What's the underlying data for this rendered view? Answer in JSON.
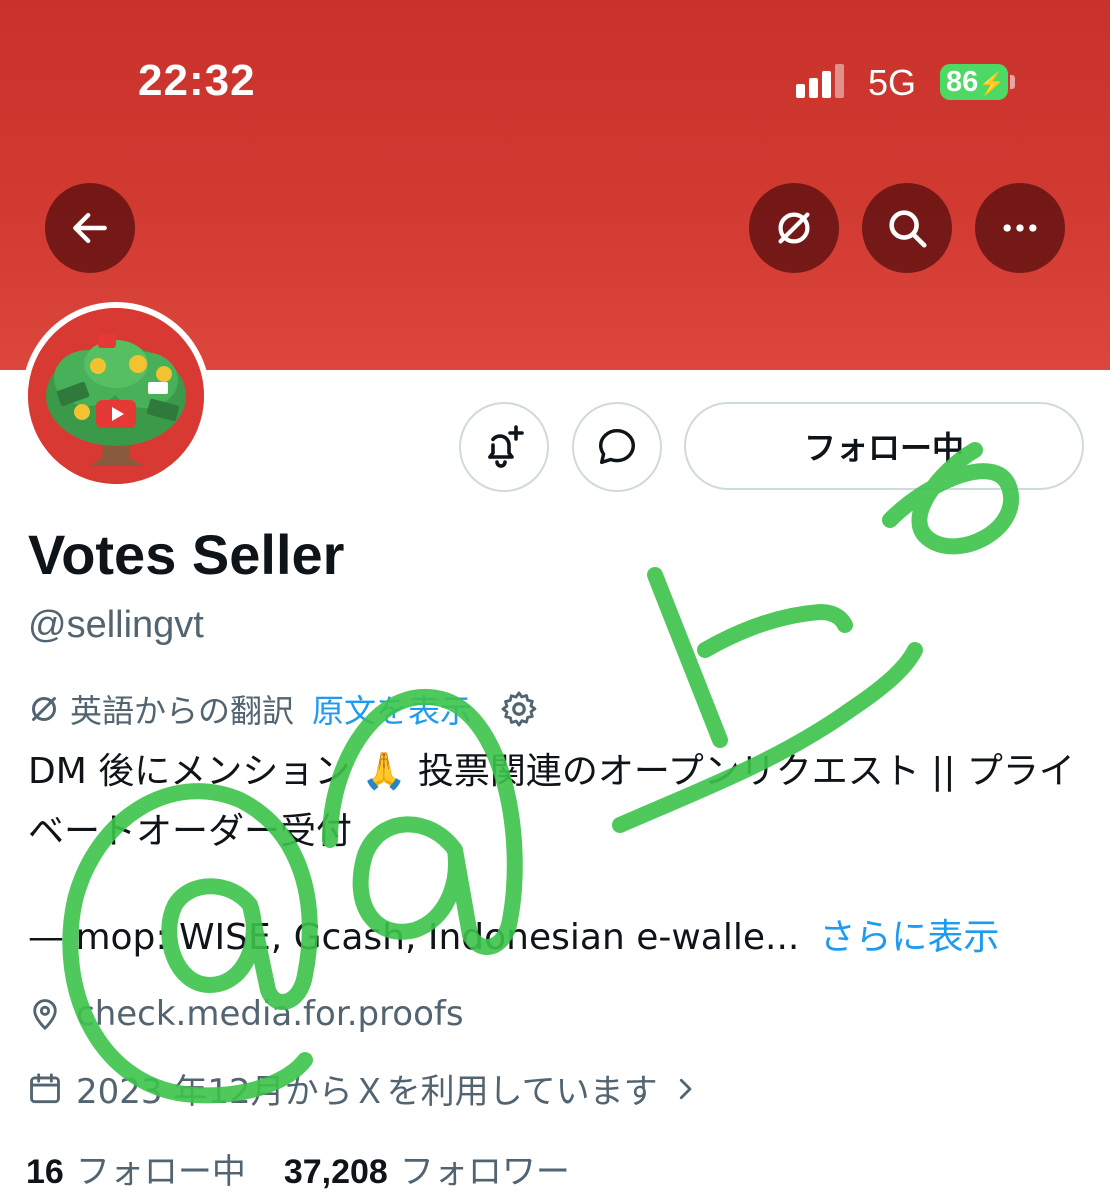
{
  "status_bar": {
    "time": "22:32",
    "network": "5G",
    "battery": "86",
    "battery_color": "#4cd964"
  },
  "header": {
    "banner_color": "#d03a31",
    "back_icon": "arrow-left-icon",
    "translate_icon": "translate-icon",
    "search_icon": "search-icon",
    "more_icon": "more-horizontal-icon"
  },
  "profile": {
    "display_name": "Votes Seller",
    "handle": "@sellingvt",
    "follow_button_label": "フォロー中",
    "notify_icon": "bell-plus-icon",
    "message_icon": "message-bubble-icon"
  },
  "translation": {
    "label": "英語からの翻訳",
    "show_original": "原文を表示"
  },
  "bio": {
    "line1": "DM 後にメンション 🙏 投票関連のオープンリクエスト || プライベートオーダー受付",
    "line2": "— mop: WISE, Gcash, Indonesian e-walle...",
    "more_link": "さらに表示"
  },
  "meta": {
    "location": "check.media.for.proofs",
    "joined": "2023 年12月からＸを利用しています"
  },
  "stats": {
    "following_count": "16",
    "following_label": "フォロー中",
    "followers_count": "37,208",
    "followers_label": "フォロワー"
  },
  "accent_color": "#1d9bf0",
  "annotation_color": "#3cc34a"
}
